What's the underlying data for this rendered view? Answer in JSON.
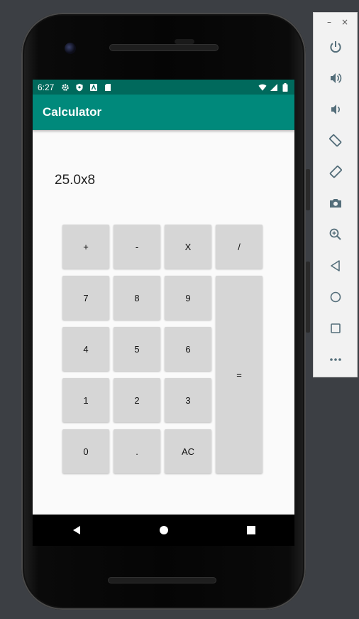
{
  "status_bar": {
    "time": "6:27",
    "left_icons": [
      "gear-icon",
      "shield-icon",
      "a-box-icon",
      "sd-card-icon"
    ],
    "right_icons": [
      "wifi-icon",
      "signal-icon",
      "battery-icon"
    ]
  },
  "app_bar": {
    "title": "Calculator"
  },
  "display": {
    "expression": "25.0x8"
  },
  "keys": {
    "plus": "+",
    "minus": "-",
    "multiply": "X",
    "divide": "/",
    "seven": "7",
    "eight": "8",
    "nine": "9",
    "four": "4",
    "five": "5",
    "six": "6",
    "one": "1",
    "two": "2",
    "three": "3",
    "zero": "0",
    "dot": ".",
    "ac": "AC",
    "equals": "="
  },
  "toolbar": {
    "minimize": "–",
    "close": "×",
    "items": [
      "power-icon",
      "volume-up-icon",
      "volume-down-icon",
      "rotate-left-icon",
      "rotate-right-icon",
      "camera-icon",
      "zoom-icon",
      "back-icon",
      "home-icon",
      "overview-icon",
      "more-icon"
    ]
  },
  "colors": {
    "status_bar": "#00695c",
    "app_bar": "#00897b",
    "key": "#d6d6d6",
    "toolbar_icon": "#546e7a"
  }
}
